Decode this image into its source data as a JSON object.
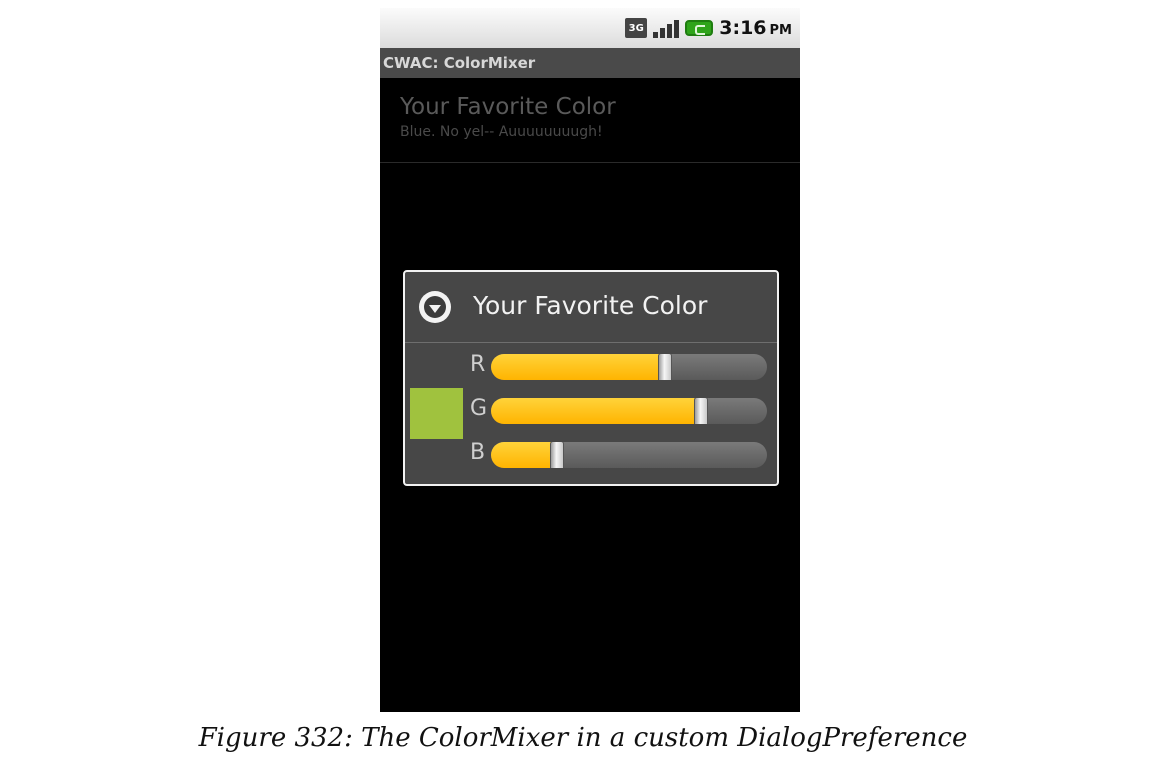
{
  "status_bar": {
    "network_badge": "3G",
    "time": "3:16",
    "ampm": "PM",
    "icons": [
      "3g-icon",
      "signal-icon",
      "battery-charging-icon"
    ]
  },
  "app": {
    "title": "CWAC: ColorMixer"
  },
  "preference": {
    "title": "Your Favorite Color",
    "summary": "Blue.  No yel--  Auuuuuuuugh!"
  },
  "dialog": {
    "title": "Your Favorite Color",
    "icon": "dropdown-arrow-icon",
    "swatch_color": "#a0c23e",
    "sliders": [
      {
        "label": "R",
        "fraction": 0.63
      },
      {
        "label": "G",
        "fraction": 0.76
      },
      {
        "label": "B",
        "fraction": 0.24
      }
    ]
  },
  "caption": "Figure 332: The ColorMixer in a custom DialogPreference"
}
